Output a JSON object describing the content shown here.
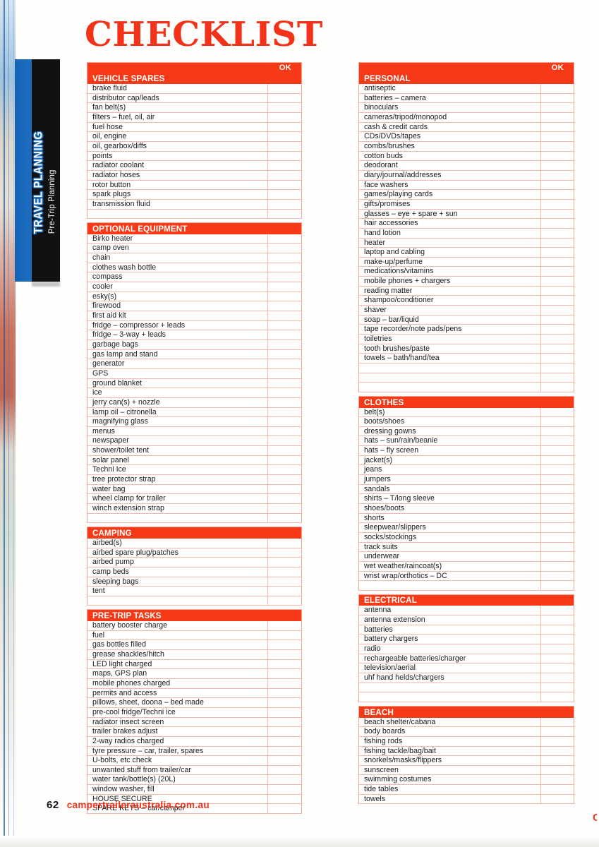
{
  "page": {
    "title": "CHECKLIST",
    "folio": "62",
    "website": "campertraileraustralia.com.au",
    "edge_glyph": "C",
    "accent_color": "#f63a17",
    "rule_color": "#f9b9a8",
    "tab_blue": "#1663b5",
    "tab_black": "#111113"
  },
  "sidebar_tab": {
    "title": "TRAVEL PLANNING",
    "subtitle": "Pre-Trip Planning"
  },
  "ok_column_label": "OK",
  "columns": [
    {
      "name": "left",
      "sections": [
        {
          "heading": "VEHICLE SPARES",
          "show_ok": true,
          "items": [
            "brake fluid",
            "distributor cap/leads",
            "fan belt(s)",
            "filters – fuel, oil, air",
            "fuel hose",
            "oil, engine",
            "oil, gearbox/diffs",
            "points",
            "radiator coolant",
            "radiator hoses",
            "rotor button",
            "spark plugs",
            "transmission fluid"
          ],
          "blank_rows": 1
        },
        {
          "heading": "OPTIONAL EQUIPMENT",
          "show_ok": false,
          "items": [
            "Birko heater",
            "camp oven",
            "chain",
            "clothes wash bottle",
            "compass",
            "cooler",
            "esky(s)",
            "firewood",
            "first aid kit",
            "fridge – compressor + leads",
            "fridge – 3-way + leads",
            "garbage bags",
            "gas lamp and stand",
            "generator",
            "GPS",
            "ground blanket",
            "ice",
            "jerry can(s) + nozzle",
            "lamp oil – citronella",
            "magnifying glass",
            "menus",
            "newspaper",
            "shower/toilet tent",
            "solar panel",
            "Techni Ice",
            "tree protector strap",
            "water bag",
            "wheel clamp for trailer",
            "winch extension strap"
          ],
          "blank_rows": 1
        },
        {
          "heading": "CAMPING",
          "show_ok": false,
          "items": [
            "airbed(s)",
            "airbed spare plug/patches",
            "airbed pump",
            "camp beds",
            "sleeping bags",
            "tent"
          ],
          "blank_rows": 1
        },
        {
          "heading": "PRE-TRIP TASKS",
          "show_ok": false,
          "items": [
            "battery booster charge",
            "fuel",
            "gas bottles filled",
            "grease shackles/hitch",
            "LED light charged",
            "maps, GPS plan",
            "mobile phones charged",
            "permits and access",
            "pillows, sheet, doona – bed made",
            "pre-cool fridge/Techni ice",
            "radiator insect screen",
            "trailer brakes adjust",
            "2-way radios charged",
            "tyre pressure – car, trailer, spares",
            "U-bolts, etc check",
            "unwanted stuff from trailer/car",
            "water tank/bottle(s) (20L)",
            "window washer, fill",
            "HOUSE SECURE",
            "SPARE KEYS – car/camper"
          ],
          "blank_rows": 0
        }
      ]
    },
    {
      "name": "right",
      "sections": [
        {
          "heading": "PERSONAL",
          "show_ok": true,
          "items": [
            "antiseptic",
            "batteries – camera",
            "binoculars",
            "cameras/tripod/monopod",
            "cash & credit cards",
            "CDs/DVDs/tapes",
            "combs/brushes",
            "cotton buds",
            "deodorant",
            "diary/journal/addresses",
            "face washers",
            "games/playing cards",
            "gifts/promises",
            "glasses – eye + spare + sun",
            "hair accessories",
            "hand lotion",
            "heater",
            "laptop and cabling",
            "make-up/perfume",
            "medications/vitamins",
            "mobile phones + chargers",
            "reading matter",
            "shampoo/conditioner",
            "shaver",
            "soap – bar/liquid",
            "tape recorder/note pads/pens",
            "toiletries",
            "tooth brushes/paste",
            "towels – bath/hand/tea"
          ],
          "blank_rows": 3
        },
        {
          "heading": "CLOTHES",
          "show_ok": false,
          "items": [
            "belt(s)",
            "boots/shoes",
            "dressing gowns",
            "hats – sun/rain/beanie",
            "hats – fly screen",
            "jacket(s)",
            "jeans",
            "jumpers",
            "sandals",
            "shirts – T/long sleeve",
            "shoes/boots",
            "shorts",
            "sleepwear/slippers",
            "socks/stockings",
            "track suits",
            "underwear",
            "wet weather/raincoat(s)",
            "wrist wrap/orthotics – DC"
          ],
          "blank_rows": 1
        },
        {
          "heading": "ELECTRICAL",
          "show_ok": false,
          "items": [
            "antenna",
            "antenna extension",
            "batteries",
            "battery chargers",
            "radio",
            "rechargeable batteries/charger",
            "television/aerial",
            "uhf hand helds/chargers"
          ],
          "blank_rows": 2
        },
        {
          "heading": "BEACH",
          "show_ok": false,
          "items": [
            "beach shelter/cabana",
            "body boards",
            "fishing rods",
            "fishing tackle/bag/bait",
            "snorkels/masks/flippers",
            "sunscreen",
            "swimming costumes",
            "tide tables",
            "towels"
          ],
          "blank_rows": 0
        }
      ]
    }
  ]
}
